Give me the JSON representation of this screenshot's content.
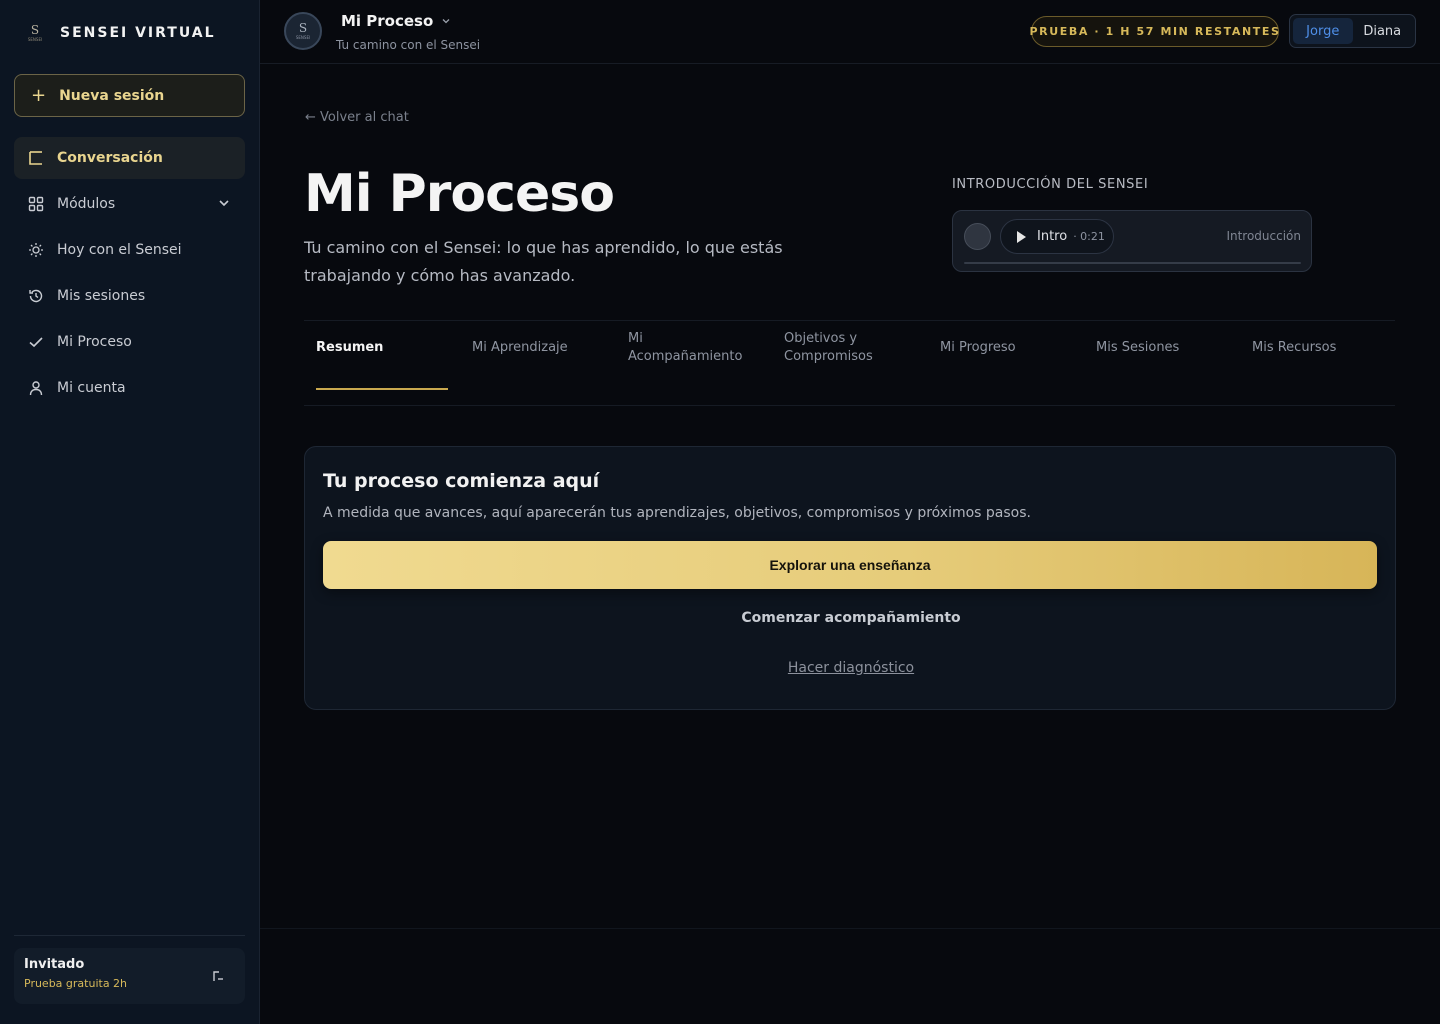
{
  "sidebar": {
    "brand": "SENSEI VIRTUAL",
    "new_session": "Nueva sesión",
    "items": [
      {
        "label": "Conversación",
        "icon": "chat-icon",
        "active": true
      },
      {
        "label": "Módulos",
        "icon": "grid-icon",
        "has_submenu": true
      },
      {
        "label": "Hoy con el Sensei",
        "icon": "sun-icon"
      },
      {
        "label": "Mis sesiones",
        "icon": "history-icon"
      },
      {
        "label": "Mi Proceso",
        "icon": "check-icon"
      },
      {
        "label": "Mi cuenta",
        "icon": "user-icon"
      }
    ],
    "user": {
      "name": "Invitado",
      "plan": "Prueba gratuita 2h"
    }
  },
  "topbar": {
    "title": "Mi Proceso",
    "subtitle": "Tu camino con el Sensei",
    "trial": "PRUEBA · 1 H 57 MIN RESTANTES",
    "users": [
      {
        "label": "Jorge",
        "active": true
      },
      {
        "label": "Diana",
        "active": false
      }
    ]
  },
  "main": {
    "back": "← Volver al chat",
    "title": "Mi Proceso",
    "description": "Tu camino con el Sensei: lo que has aprendido, lo que estás trabajando y cómo has avanzado.",
    "intro": {
      "label": "INTRODUCCIÓN DEL SENSEI",
      "play_label": "Intro",
      "duration": "· 0:21",
      "tag": "Introducción",
      "progress": 0
    },
    "tabs": [
      {
        "label": "Resumen",
        "active": true
      },
      {
        "label": "Mi Aprendizaje"
      },
      {
        "label": "Mi Acompañamiento"
      },
      {
        "label": "Objetivos y Compromisos"
      },
      {
        "label": "Mi Progreso"
      },
      {
        "label": "Mis Sesiones"
      },
      {
        "label": "Mis Recursos"
      }
    ],
    "empty": {
      "title": "Tu proceso comienza aquí",
      "description": "A medida que avances, aquí aparecerán tus aprendizajes, objetivos, compromisos y próximos pasos.",
      "primary": "Explorar una enseñanza",
      "secondary": "Comenzar acompañamiento",
      "link": "Hacer diagnóstico"
    }
  },
  "colors": {
    "accent": "#e6cc7a",
    "link_blue": "#4f8fe8",
    "background": "#07090e",
    "sidebar": "#0c1522"
  }
}
